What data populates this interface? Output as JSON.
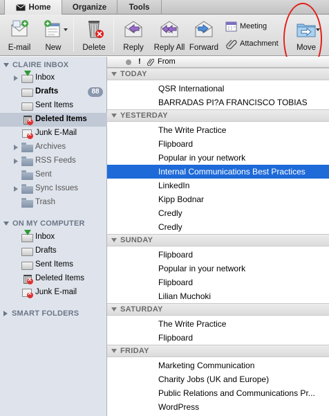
{
  "tabs": [
    "Home",
    "Organize",
    "Tools"
  ],
  "toolbar": {
    "email": "E-mail",
    "new": "New",
    "delete": "Delete",
    "reply": "Reply",
    "reply_all": "Reply All",
    "forward": "Forward",
    "meeting": "Meeting",
    "attachment": "Attachment",
    "move": "Move"
  },
  "sidebar": {
    "claire_header": "CLAIRE INBOX",
    "claire_items": [
      {
        "label": "Inbox"
      },
      {
        "label": "Drafts",
        "badge": "88"
      },
      {
        "label": "Sent Items"
      },
      {
        "label": "Deleted Items"
      },
      {
        "label": "Junk E-Mail"
      },
      {
        "label": "Archives"
      },
      {
        "label": "RSS Feeds"
      },
      {
        "label": "Sent"
      },
      {
        "label": "Sync Issues"
      },
      {
        "label": "Trash"
      }
    ],
    "computer_header": "ON MY COMPUTER",
    "computer_items": [
      {
        "label": "Inbox"
      },
      {
        "label": "Drafts"
      },
      {
        "label": "Sent Items"
      },
      {
        "label": "Deleted Items"
      },
      {
        "label": "Junk E-mail"
      }
    ],
    "smart_header": "SMART FOLDERS"
  },
  "list": {
    "column_from": "From",
    "column_flag": "!",
    "groups": [
      {
        "label": "TODAY",
        "senders": [
          "QSR International",
          "BARRADAS PI?A FRANCISCO TOBIAS"
        ]
      },
      {
        "label": "YESTERDAY",
        "senders": [
          "The Write Practice",
          "Flipboard",
          "Popular in your network",
          "Internal Communications Best Practices",
          "LinkedIn",
          "Kipp Bodnar",
          "Credly",
          "Credly"
        ]
      },
      {
        "label": "SUNDAY",
        "senders": [
          "Flipboard",
          "Popular in your network",
          "Flipboard",
          "Lilian Muchoki"
        ]
      },
      {
        "label": "SATURDAY",
        "senders": [
          "The Write Practice",
          "Flipboard"
        ]
      },
      {
        "label": "FRIDAY",
        "senders": [
          "Marketing Communication",
          "Charity Jobs  (UK and Europe)",
          "Public Relations and Communications Pr...",
          "WordPress"
        ]
      }
    ]
  },
  "colors": {
    "selection": "#1e6ad9",
    "sidebar_bg": "#dfe4ec",
    "callout": "#e0201a"
  }
}
